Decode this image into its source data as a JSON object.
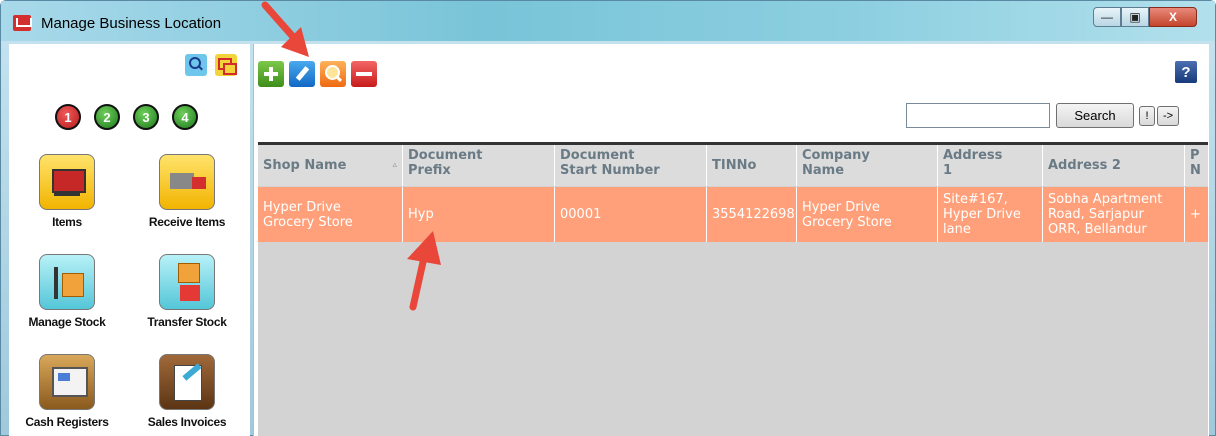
{
  "window": {
    "title": "Manage Business Location",
    "controls": {
      "minimize": "—",
      "maximize": "▣",
      "close": "X"
    }
  },
  "left_panel": {
    "steps": [
      "1",
      "2",
      "3",
      "4"
    ],
    "tiles": [
      {
        "label": "Items",
        "icon": "cart-icon"
      },
      {
        "label": "Receive Items",
        "icon": "truck-icon"
      },
      {
        "label": "Manage Stock",
        "icon": "stock-icon"
      },
      {
        "label": "Transfer Stock",
        "icon": "transfer-icon"
      },
      {
        "label": "Cash Registers",
        "icon": "register-icon"
      },
      {
        "label": "Sales Invoices",
        "icon": "invoice-icon"
      }
    ]
  },
  "toolbar": {
    "help": "?"
  },
  "search": {
    "value": "",
    "button": "Search",
    "bang": "!",
    "arrow": "->"
  },
  "grid": {
    "columns": [
      "Shop Name",
      "Document\nPrefix",
      "Document\nStart Number",
      "TINNo",
      "Company\nName",
      "Address\n1",
      "Address 2",
      "P\nN"
    ],
    "rows": [
      [
        "Hyper Drive\nGrocery Store",
        "Hyp",
        "00001",
        "3554122698",
        "Hyper Drive\nGrocery Store",
        "Site#167,\nHyper Drive\nlane",
        "Sobha Apartment\nRoad, Sarjapur\nORR, Bellandur",
        "+"
      ]
    ]
  },
  "colors": {
    "selected_row": "#ffa07a",
    "grid_bg": "#d3d3d3",
    "arrow": "#e8473a"
  }
}
